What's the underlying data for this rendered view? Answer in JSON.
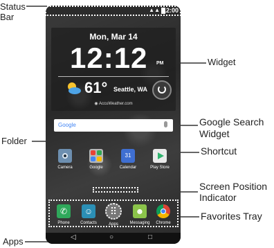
{
  "callouts": {
    "status_bar": "Status\nBar",
    "widget": "Widget",
    "google_search_widget": "Google Search\nWidget",
    "folder": "Folder",
    "shortcut": "Shortcut",
    "screen_position_indicator": "Screen Position\nIndicator",
    "favorites_tray": "Favorites Tray",
    "apps": "Apps"
  },
  "status": {
    "time": "12:00",
    "signal": "▲▲"
  },
  "widget": {
    "date": "Mon, Mar 14",
    "clock": "12:12",
    "ampm": "PM",
    "temperature": "61°",
    "city": "Seattle, WA",
    "credit": "◉ AccuWeather.com"
  },
  "search": {
    "logo": "Google"
  },
  "apps": [
    {
      "label": "Camera",
      "color": "#6d8fb0"
    },
    {
      "label": "Google",
      "color": "#b8b8b8"
    },
    {
      "label": "Calendar",
      "color": "#3f6fd1",
      "glyph": "31"
    },
    {
      "label": "Play Store",
      "color": "#eaeaea"
    }
  ],
  "dock": [
    {
      "label": "Phone",
      "color": "#2fa85b",
      "glyph": "✆"
    },
    {
      "label": "Contacts",
      "color": "#2b8fb5",
      "glyph": "☺"
    },
    {
      "label": "Apps",
      "color": "#999999",
      "glyph": "⠿"
    },
    {
      "label": "Messaging",
      "color": "#8bc34a",
      "glyph": "☻"
    },
    {
      "label": "Chrome",
      "color": "#d64b3b",
      "glyph": "◉"
    }
  ],
  "navbar": {
    "back": "◁",
    "home": "○",
    "recent": "□"
  }
}
